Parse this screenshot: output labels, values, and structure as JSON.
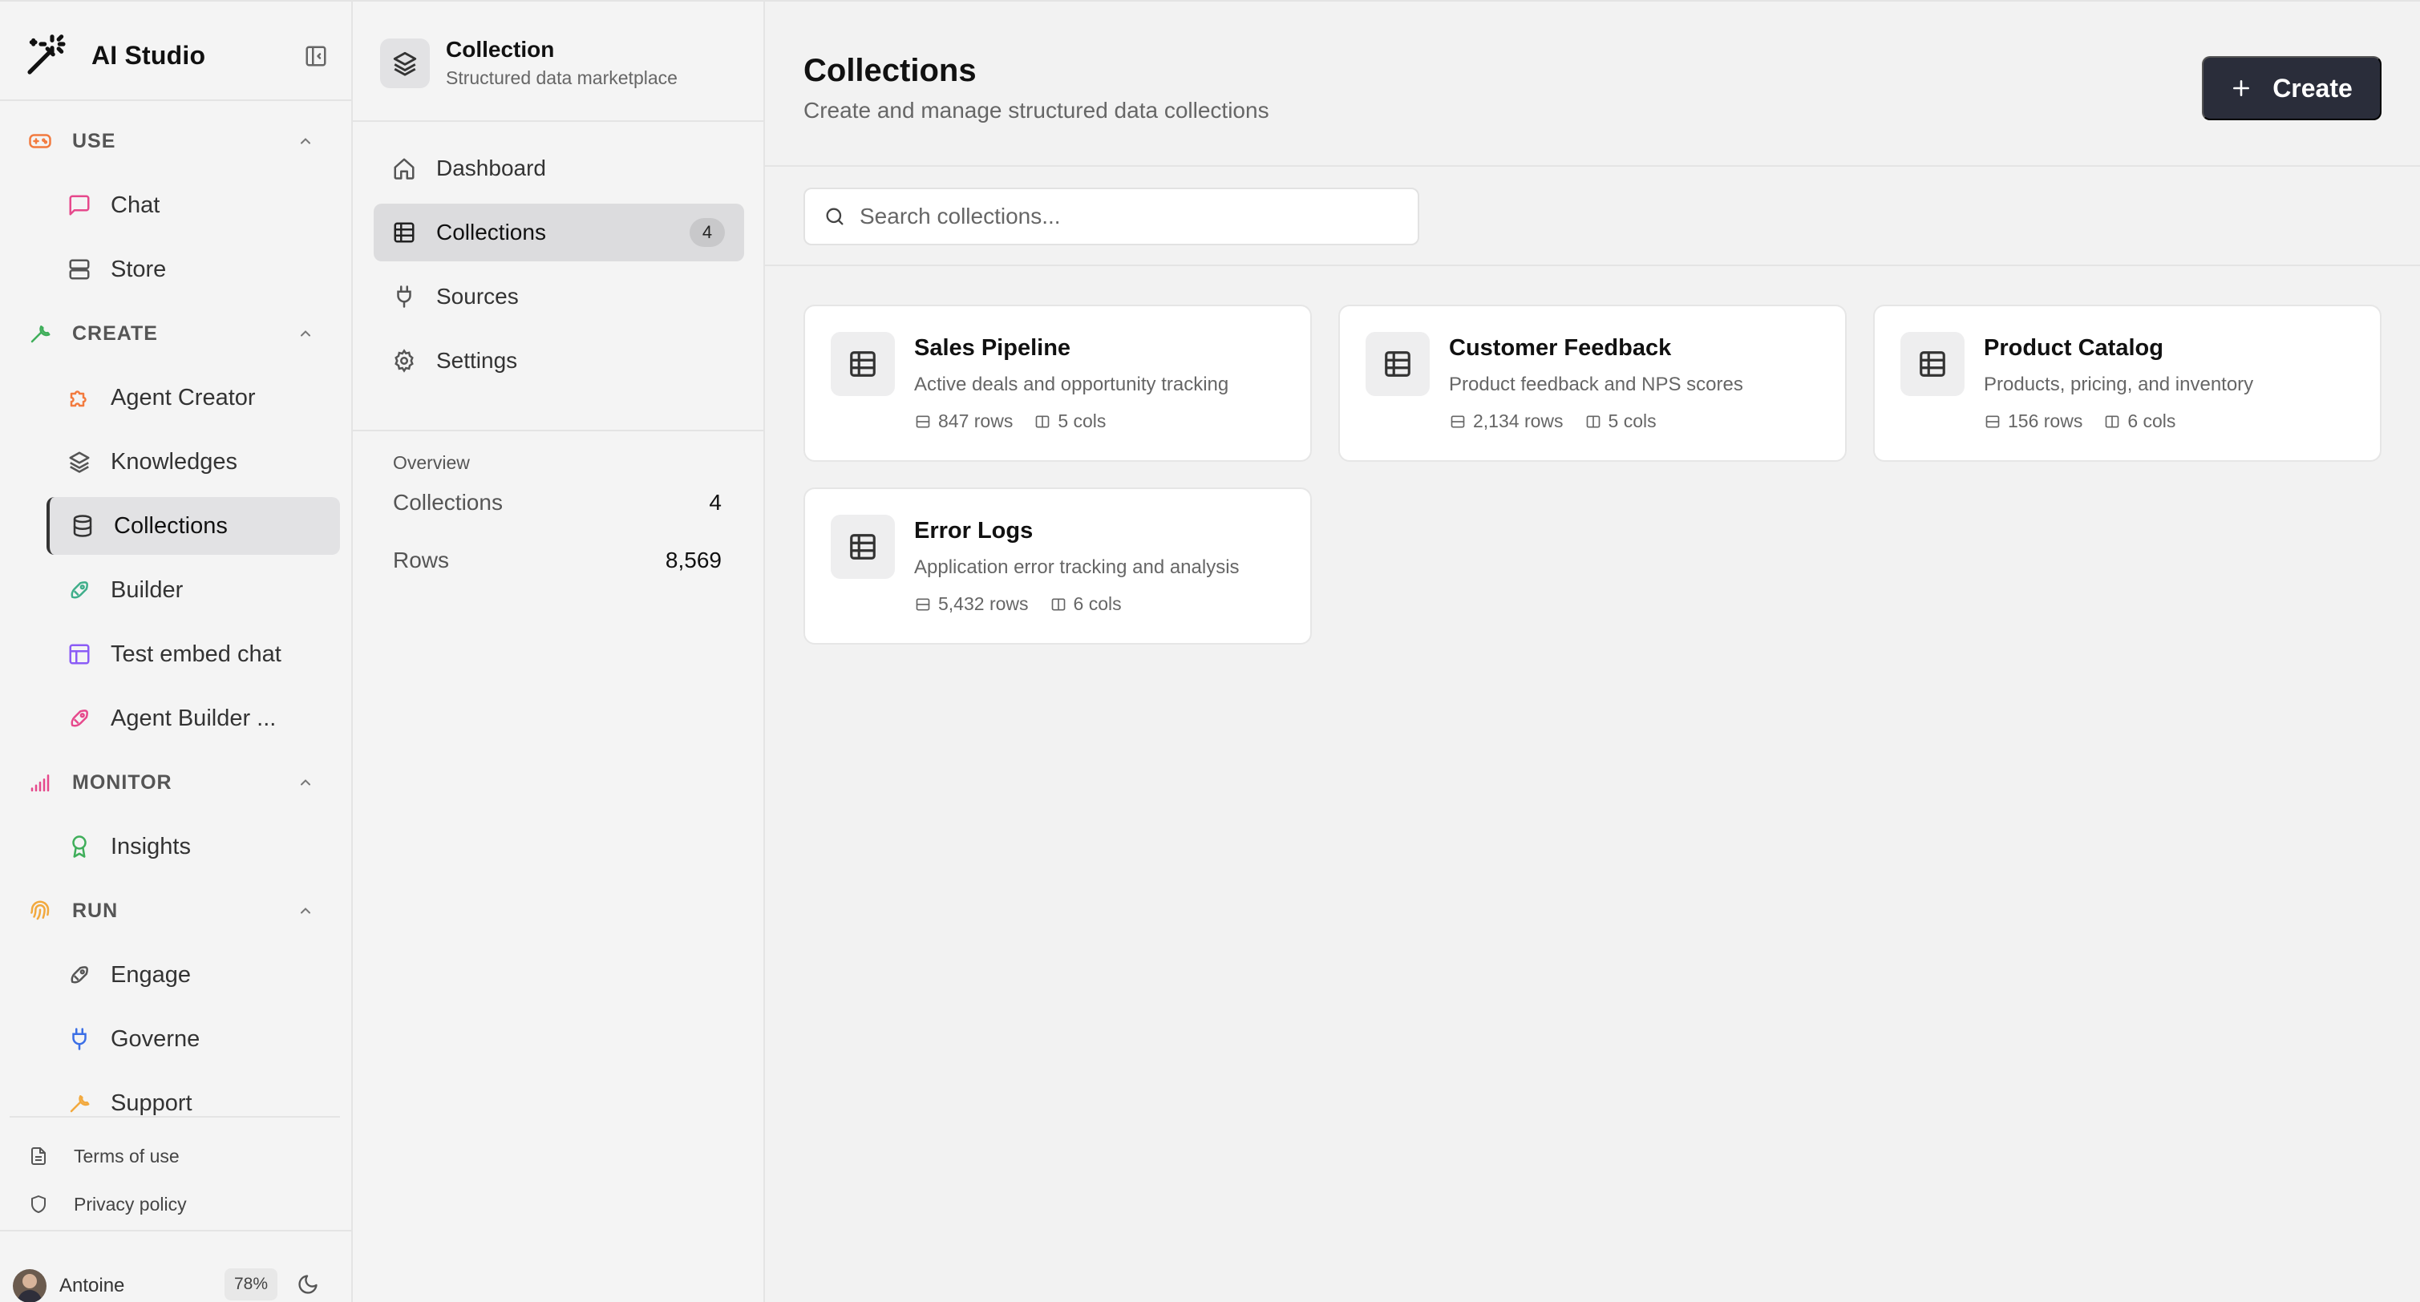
{
  "sidebar": {
    "brand": "AI Studio",
    "sections": [
      {
        "label": "USE",
        "icon": "gamepad-icon",
        "color": "#f27a3e",
        "items": [
          {
            "label": "Chat",
            "icon": "message-icon",
            "color": "#e6498c"
          },
          {
            "label": "Store",
            "icon": "server-icon",
            "color": "#555555"
          }
        ]
      },
      {
        "label": "CREATE",
        "icon": "wrench-icon",
        "color": "#3fae5a",
        "items": [
          {
            "label": "Agent Creator",
            "icon": "puzzle-icon",
            "color": "#f27a3e"
          },
          {
            "label": "Knowledges",
            "icon": "layers-icon",
            "color": "#555555"
          },
          {
            "label": "Collections",
            "icon": "database-icon",
            "color": "#333333",
            "active": true
          },
          {
            "label": "Builder",
            "icon": "rocket-icon",
            "color": "#3fae8a"
          },
          {
            "label": "Test embed chat",
            "icon": "layout-icon",
            "color": "#8b5cf6"
          },
          {
            "label": "Agent Builder ...",
            "icon": "rocket-icon",
            "color": "#e6498c"
          }
        ]
      },
      {
        "label": "MONITOR",
        "icon": "signal-icon",
        "color": "#e6498c",
        "items": [
          {
            "label": "Insights",
            "icon": "award-icon",
            "color": "#3fae5a"
          }
        ]
      },
      {
        "label": "RUN",
        "icon": "fingerprint-icon",
        "color": "#f2a93e",
        "items": [
          {
            "label": "Engage",
            "icon": "rocket-icon",
            "color": "#555555"
          },
          {
            "label": "Governe",
            "icon": "plug-icon",
            "color": "#3b6fe6"
          },
          {
            "label": "Support",
            "icon": "wrench-icon",
            "color": "#f2a93e"
          }
        ]
      }
    ],
    "footer": [
      {
        "label": "Terms of use",
        "icon": "document-icon"
      },
      {
        "label": "Privacy policy",
        "icon": "shield-icon"
      }
    ],
    "user": {
      "name": "Antoine",
      "usage": "78%"
    }
  },
  "panel": {
    "title": "Collection",
    "subtitle": "Structured data marketplace",
    "nav": [
      {
        "label": "Dashboard",
        "icon": "home-icon"
      },
      {
        "label": "Collections",
        "icon": "table-icon",
        "count": "4",
        "active": true
      },
      {
        "label": "Sources",
        "icon": "plug-icon"
      },
      {
        "label": "Settings",
        "icon": "gear-icon"
      }
    ],
    "overview": {
      "title": "Overview",
      "rows": [
        {
          "label": "Collections",
          "value": "4"
        },
        {
          "label": "Rows",
          "value": "8,569"
        }
      ]
    }
  },
  "main": {
    "title": "Collections",
    "subtitle": "Create and manage structured data collections",
    "create_label": "Create",
    "search_placeholder": "Search collections...",
    "cards": [
      {
        "title": "Sales Pipeline",
        "description": "Active deals and opportunity tracking",
        "rows": "847 rows",
        "cols": "5 cols"
      },
      {
        "title": "Customer Feedback",
        "description": "Product feedback and NPS scores",
        "rows": "2,134 rows",
        "cols": "5 cols"
      },
      {
        "title": "Product Catalog",
        "description": "Products, pricing, and inventory",
        "rows": "156 rows",
        "cols": "6 cols"
      },
      {
        "title": "Error Logs",
        "description": "Application error tracking and analysis",
        "rows": "5,432 rows",
        "cols": "6 cols"
      }
    ]
  }
}
